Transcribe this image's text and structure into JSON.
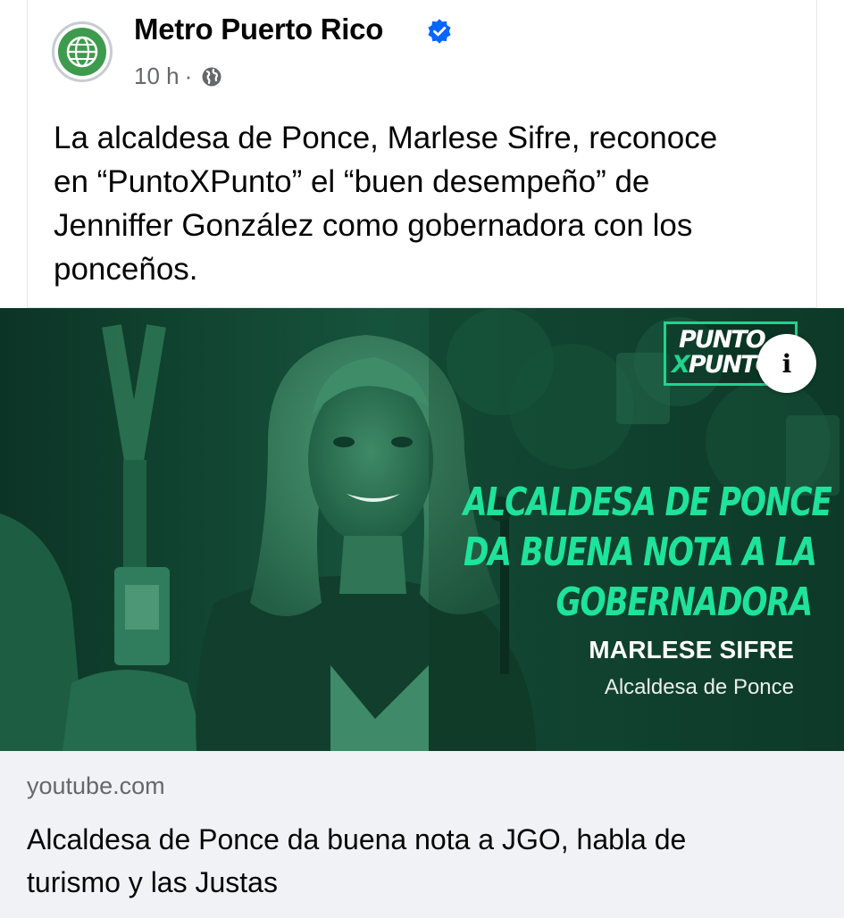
{
  "post": {
    "page_name": "Metro Puerto Rico",
    "time": "10 h",
    "separator": "·",
    "lines": [
      "La alcaldesa de Ponce, Marlese Sifre, reconoce",
      "en “PuntoXPunto” el “buen desempeño” de",
      "Jenniffer González como gobernadora con los",
      "ponceños."
    ],
    "icons": {
      "avatar": "globe-logo-icon",
      "verified": "verified-badge-icon",
      "audience": "globe-icon"
    }
  },
  "media": {
    "logo_line1": "PUNTO",
    "logo_line2": "PUNTO",
    "info_label": "i",
    "headline": [
      "ALCALDESA DE PONCE",
      "DA BUENA NOTA A LA",
      "GOBERNADORA"
    ],
    "speaker_name": "MARLESE SIFRE",
    "speaker_role": "Alcaldesa de Ponce"
  },
  "link": {
    "domain": "youtube.com",
    "title_lines": [
      "Alcaldesa de Ponce da buena nota a JGO, habla de",
      "turismo y las Justas"
    ]
  },
  "colors": {
    "accent_green": "#1ee39a",
    "verified_blue": "#0866ff",
    "media_bg": "#10412f",
    "link_bg": "#f0f2f5"
  }
}
